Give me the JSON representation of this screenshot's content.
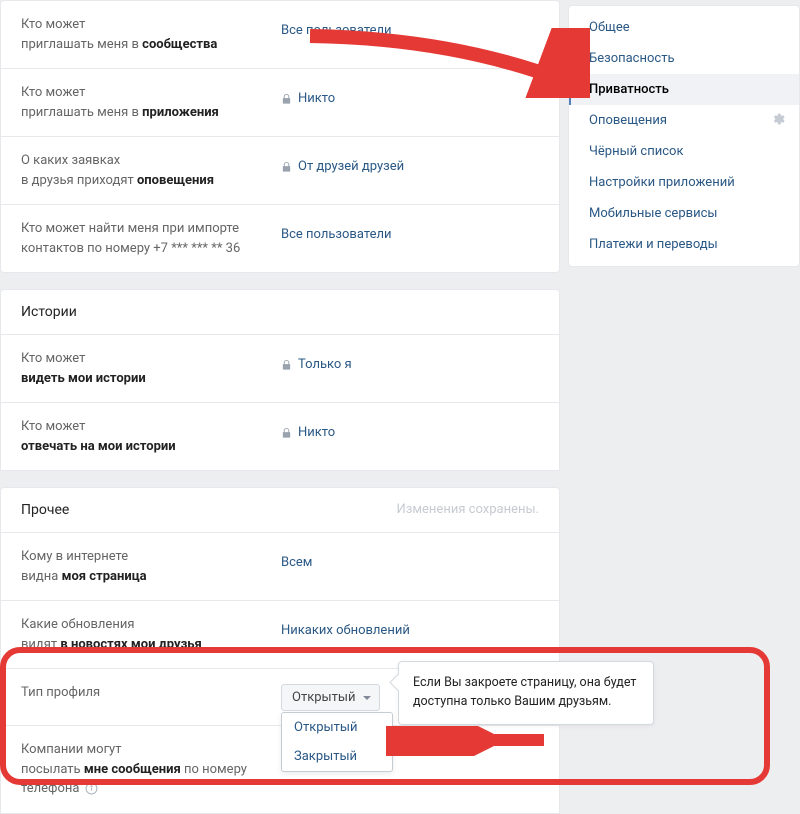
{
  "sidebar": {
    "items": [
      {
        "label": "Общее"
      },
      {
        "label": "Безопасность"
      },
      {
        "label": "Приватность"
      },
      {
        "label": "Оповещения"
      },
      {
        "label": "Чёрный список"
      },
      {
        "label": "Настройки приложений"
      },
      {
        "label": "Мобильные сервисы"
      },
      {
        "label": "Платежи и переводы"
      }
    ],
    "active_index": 2,
    "gear_index": 3
  },
  "rows_top": [
    {
      "label_plain": "Кто может",
      "label_bold_prefix": "приглашать меня в ",
      "label_bold": "сообщества",
      "value": "Все пользователи",
      "lock": false
    },
    {
      "label_plain": "Кто может",
      "label_bold_prefix": "приглашать меня в ",
      "label_bold": "приложения",
      "value": "Никто",
      "lock": true
    },
    {
      "label_plain": "О каких заявках",
      "label_bold_prefix": "в друзья приходят ",
      "label_bold": "оповещения",
      "value": "От друзей друзей",
      "lock": true
    },
    {
      "label_plain": "Кто может найти меня при импорте",
      "label_bold_prefix": "контактов по номеру +7 *** *** ** 36",
      "label_bold": "",
      "value": "Все пользователи",
      "lock": false
    }
  ],
  "section_stories": {
    "title": "Истории",
    "rows": [
      {
        "label_plain": "Кто может",
        "label_bold_prefix": "",
        "label_bold": "видеть мои истории",
        "value": "Только я",
        "lock": true
      },
      {
        "label_plain": "Кто может",
        "label_bold_prefix": "",
        "label_bold": "отвечать на мои истории",
        "value": "Никто",
        "lock": true
      }
    ]
  },
  "section_other": {
    "title": "Прочее",
    "status": "Изменения сохранены.",
    "rows": [
      {
        "label_plain": "Кому в интернете",
        "label_bold_prefix": "видна ",
        "label_bold": "моя страница",
        "value": "Всем",
        "lock": false
      },
      {
        "label_plain": "Какие обновления",
        "label_bold_prefix": "видят ",
        "label_bold": "в новостях мои друзья",
        "value": "Никаких обновлений",
        "lock": false
      }
    ],
    "profile_type": {
      "label": "Тип профиля",
      "selected": "Открытый",
      "options": [
        "Открытый",
        "Закрытый"
      ],
      "tooltip": "Если Вы закроете страницу, она будет доступна только Вашим друзьям."
    },
    "companies_row": {
      "label_plain": "Компании могут",
      "label_bold_prefix": "посылать ",
      "label_bold": "мне сообщения",
      "label_suffix": " по номеру",
      "label_extra": "телефона"
    }
  }
}
